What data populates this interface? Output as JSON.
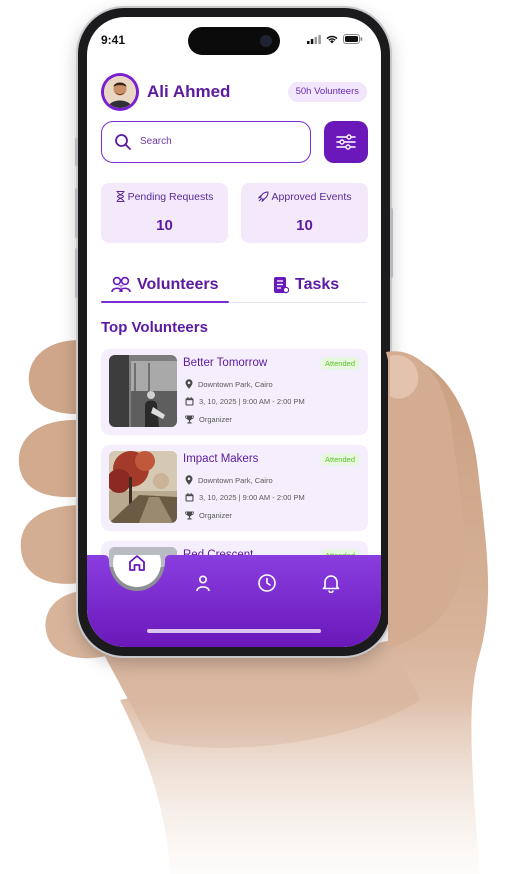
{
  "status_bar": {
    "time": "9:41"
  },
  "user": {
    "name": "Ali Ahmed",
    "hours_badge": "50h Volunteers"
  },
  "search": {
    "placeholder": "Search"
  },
  "stats": [
    {
      "label": "Pending Requests",
      "value": "10",
      "icon": "hourglass-icon"
    },
    {
      "label": "Approved Events",
      "value": "10",
      "icon": "rocket-icon"
    }
  ],
  "tabs": [
    {
      "label": "Volunteers",
      "icon": "people-icon",
      "active": true
    },
    {
      "label": "Tasks",
      "icon": "task-list-icon",
      "active": false
    }
  ],
  "section_title": "Top Volunteers",
  "volunteers": [
    {
      "name": "Better Tomorrow",
      "status": "Attended",
      "location": "Downtown Park, Cairo",
      "date": "3, 10, 2025 | 9:00 AM - 2:00 PM",
      "role": "Organizer"
    },
    {
      "name": "Impact Makers",
      "status": "Attended",
      "location": "Downtown Park, Cairo",
      "date": "3, 10, 2025 | 9:00 AM - 2:00 PM",
      "role": "Organizer"
    },
    {
      "name": "Red Crescent",
      "status": "Attended"
    }
  ],
  "nav": [
    {
      "icon": "home-icon",
      "active": true
    },
    {
      "icon": "user-icon"
    },
    {
      "icon": "clock-icon"
    },
    {
      "icon": "bell-icon"
    }
  ],
  "colors": {
    "primary": "#6a18b9",
    "primary_light": "#f3e9fb",
    "status_green": "#5cbf2a",
    "nav_gradient_top": "#8a3ee0",
    "nav_gradient_bottom": "#6a18b9"
  }
}
